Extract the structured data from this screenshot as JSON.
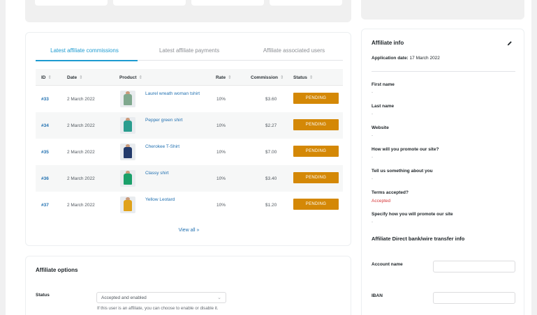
{
  "tabs": [
    {
      "label": "Latest affiliate commissions",
      "active": true
    },
    {
      "label": "Latest affiliate payments",
      "active": false
    },
    {
      "label": "Affiliate associated users",
      "active": false
    }
  ],
  "table": {
    "headers": [
      "ID",
      "Date",
      "Product",
      "Rate",
      "Commission",
      "Status"
    ],
    "sort_icon": "⇕",
    "rows": [
      {
        "id": "#33",
        "date": "2 March 2022",
        "product": "Laurel wreath woman tshirt",
        "rate": "10%",
        "commission": "$3.60",
        "status": "PENDING",
        "shirt_color": "#7fa88e"
      },
      {
        "id": "#34",
        "date": "2 March 2022",
        "product": "Pepper green shirt",
        "rate": "10%",
        "commission": "$2.27",
        "status": "PENDING",
        "shirt_color": "#2a9d8f"
      },
      {
        "id": "#35",
        "date": "2 March 2022",
        "product": "Cherokee T-Shirt",
        "rate": "10%",
        "commission": "$7.00",
        "status": "PENDING",
        "shirt_color": "#233a6b"
      },
      {
        "id": "#36",
        "date": "2 March 2022",
        "product": "Classy shirt",
        "rate": "10%",
        "commission": "$3.40",
        "status": "PENDING",
        "shirt_color": "#1aa06a"
      },
      {
        "id": "#37",
        "date": "2 March 2022",
        "product": "Yellow Leotard",
        "rate": "10%",
        "commission": "$1.20",
        "status": "PENDING",
        "shirt_color": "#e0a21a"
      }
    ]
  },
  "view_all": "View all »",
  "options": {
    "title": "Affiliate options",
    "status_label": "Status",
    "status_value": "Accepted and enabled",
    "status_help": "If this user is an affiliate, you can choose to enable or disable it."
  },
  "info": {
    "title": "Affiliate info",
    "application_date_label": "Application date:",
    "application_date": "17 March 2022",
    "fields": [
      {
        "label": "First name",
        "value": "-"
      },
      {
        "label": "Last name",
        "value": "-"
      },
      {
        "label": "Website",
        "value": "-"
      },
      {
        "label": "How will you promote our site?",
        "value": "-"
      },
      {
        "label": "Tell us something about you",
        "value": "-"
      },
      {
        "label": "Terms accepted?",
        "value": "Accepted"
      },
      {
        "label": "Specify how you will promote our site",
        "value": "-"
      }
    ],
    "bank_title": "Affiliate Direct bank/wire transfer info",
    "bank_fields": [
      {
        "label": "Account name",
        "value": ""
      },
      {
        "label": "IBAN",
        "value": ""
      }
    ]
  },
  "colors": {
    "accent": "#1d9bd1",
    "pending": "#d48806",
    "link": "#2271b1",
    "accepted": "#d63638"
  },
  "icons": {
    "edit": "pencil-icon",
    "sort": "sort-arrows-icon",
    "chevron": "chevron-down-icon"
  }
}
